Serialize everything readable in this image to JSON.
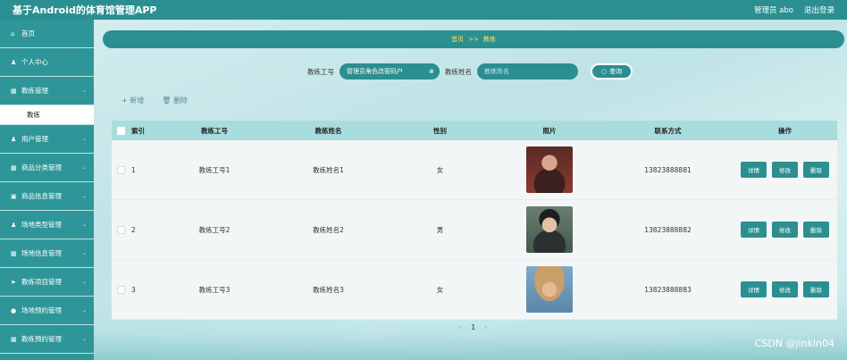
{
  "header": {
    "title": "基于Android的体育馆管理APP",
    "user": "管理员 abo",
    "logout": "退出登录"
  },
  "sidebar": {
    "items": [
      {
        "label": "首页",
        "icon": "home-icon",
        "glyph": "⌂"
      },
      {
        "label": "个人中心",
        "icon": "user-icon",
        "glyph": "♟"
      },
      {
        "label": "教练管理",
        "icon": "grid-icon",
        "glyph": "▦"
      },
      {
        "label": "用户管理",
        "icon": "users-icon",
        "glyph": "♟"
      },
      {
        "label": "商品分类管理",
        "icon": "grid-icon",
        "glyph": "▦"
      },
      {
        "label": "商品信息管理",
        "icon": "box-icon",
        "glyph": "▣"
      },
      {
        "label": "场地类型管理",
        "icon": "user-icon",
        "glyph": "♟"
      },
      {
        "label": "场地信息管理",
        "icon": "grid-icon",
        "glyph": "▦"
      },
      {
        "label": "教练项目管理",
        "icon": "send-icon",
        "glyph": "➤"
      },
      {
        "label": "场地预约管理",
        "icon": "pin-icon",
        "glyph": "●"
      },
      {
        "label": "教练预约管理",
        "icon": "grid-icon",
        "glyph": "▦"
      }
    ],
    "submenu": "教练"
  },
  "breadcrumb": {
    "home": "首页",
    "sep": ">>",
    "current": "教练"
  },
  "search": {
    "label1": "教练工号",
    "value1": "管理员角色改密码户",
    "label2": "教练姓名",
    "placeholder2": "教练姓名",
    "button": "查询"
  },
  "toolbar": {
    "add": "+ 新增",
    "delete": "删除"
  },
  "table": {
    "headers": [
      "索引",
      "教练工号",
      "教练姓名",
      "性别",
      "照片",
      "联系方式",
      "操作"
    ],
    "rows": [
      {
        "index": "1",
        "id": "教练工号1",
        "name": "教练姓名1",
        "gender": "女",
        "phone": "13823888881"
      },
      {
        "index": "2",
        "id": "教练工号2",
        "name": "教练姓名2",
        "gender": "男",
        "phone": "13823888882"
      },
      {
        "index": "3",
        "id": "教练工号3",
        "name": "教练姓名3",
        "gender": "女",
        "phone": "13823888883"
      }
    ],
    "ops": {
      "detail": "详情",
      "edit": "修改",
      "delete": "删除"
    }
  },
  "pager": {
    "prev": "‹",
    "page": "1",
    "next": "›"
  },
  "watermark": "CSDN @jinkin04",
  "colors": {
    "primary": "#2b8f91",
    "header_row": "#a9dcdd",
    "crumb_text": "#ffe05a"
  }
}
